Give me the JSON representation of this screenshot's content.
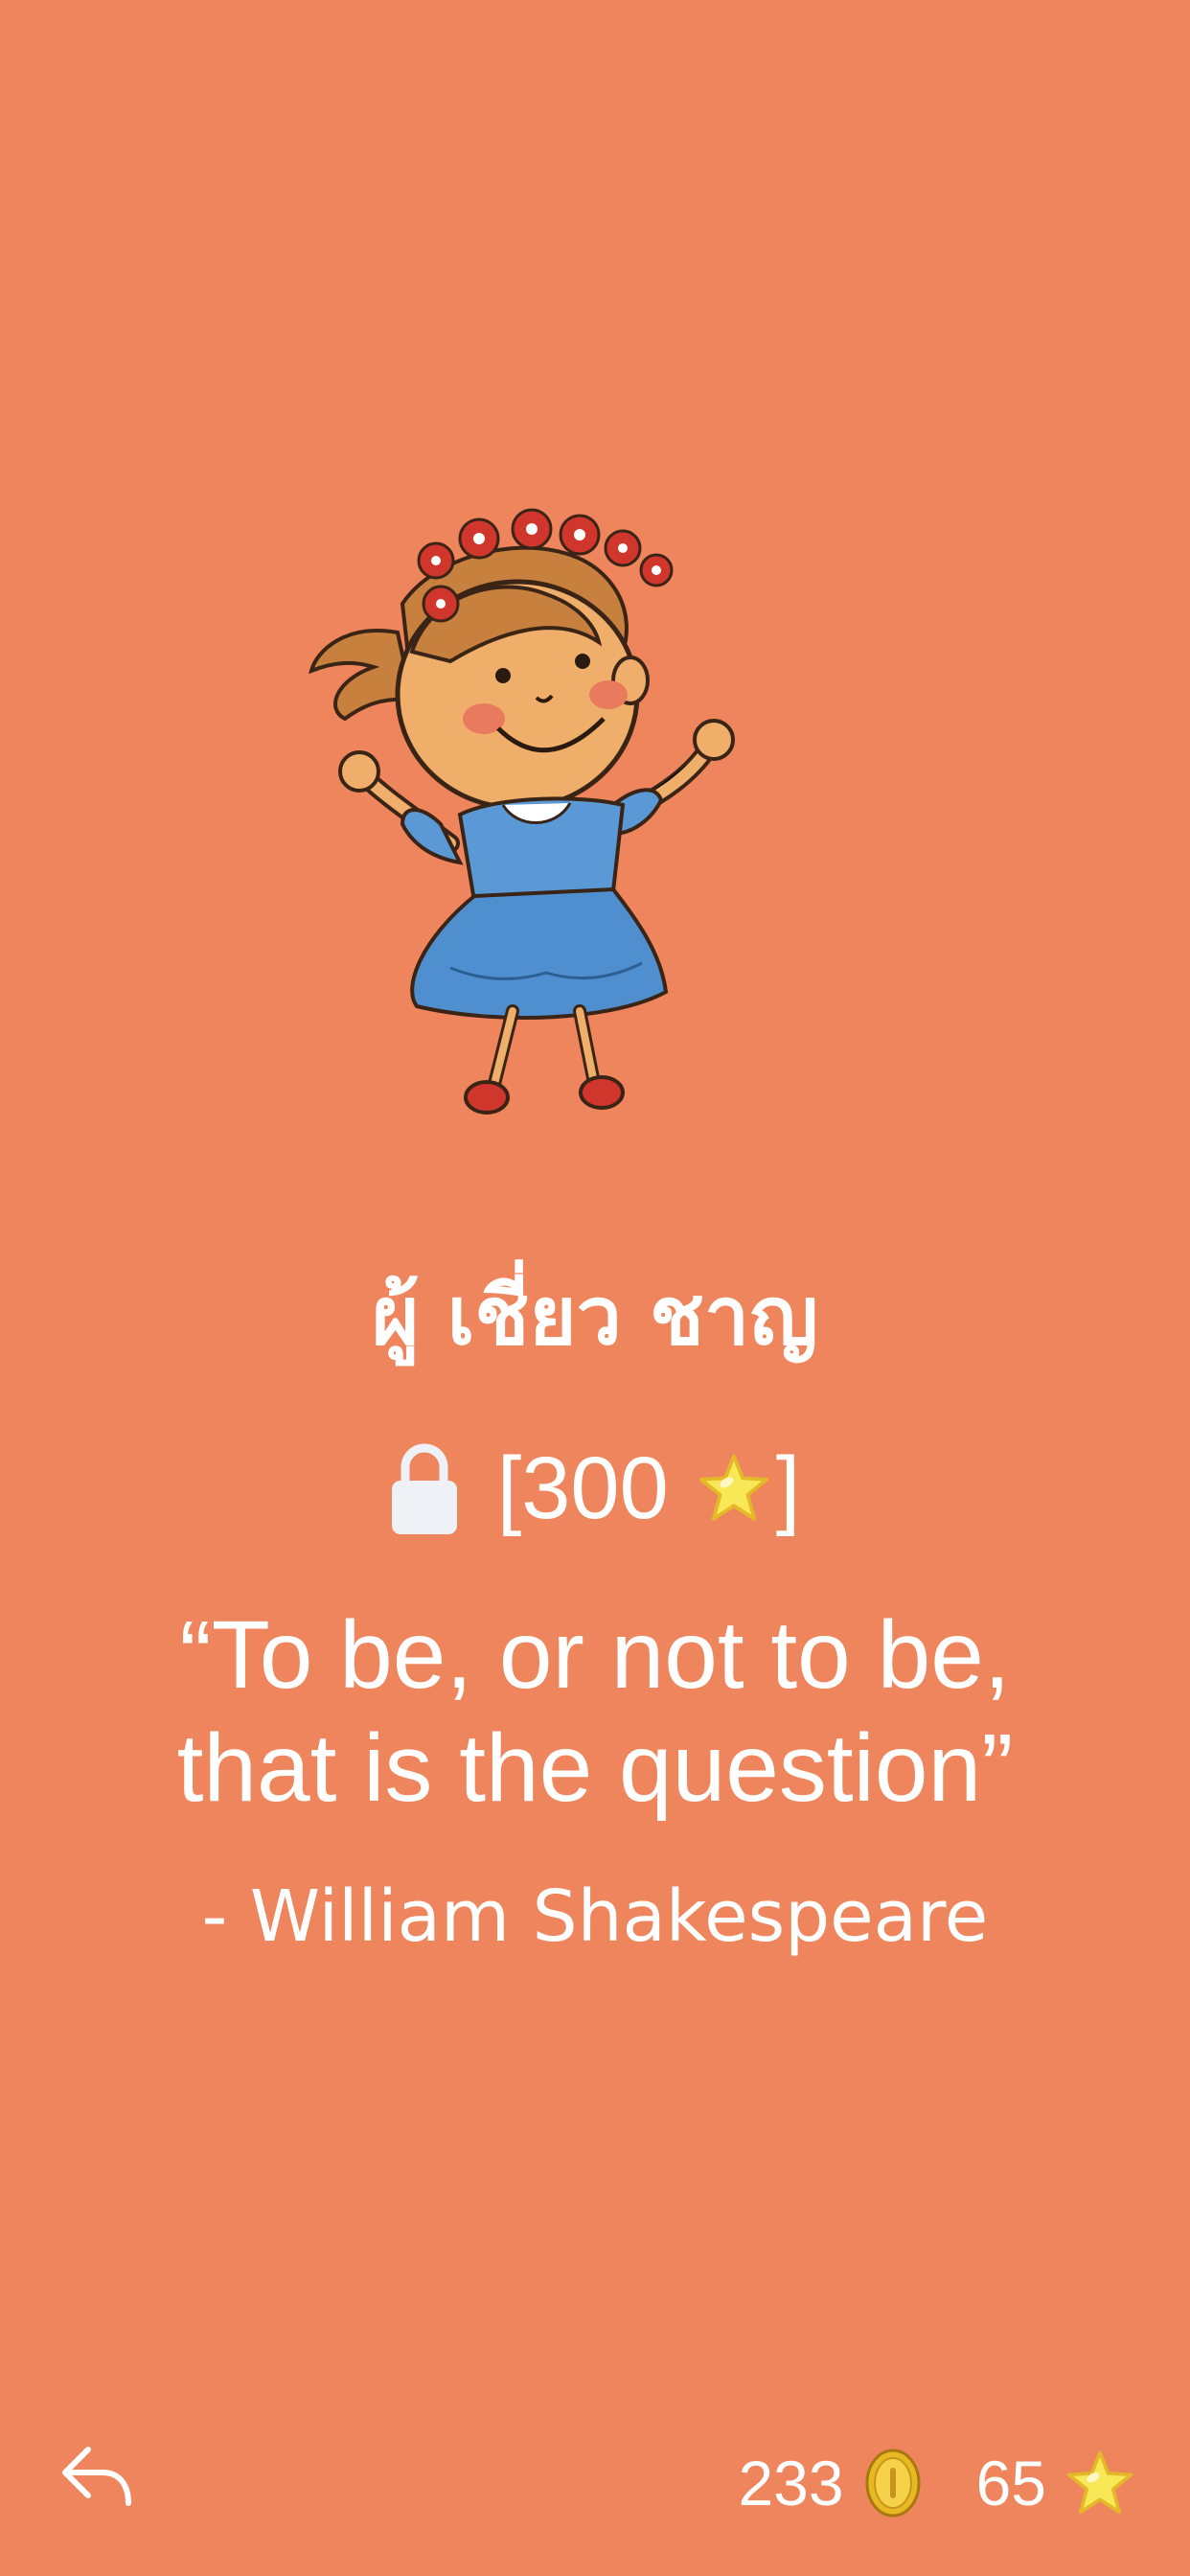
{
  "level": {
    "title": "ผู้ เชี่ยว ชาญ",
    "lock_open": "[",
    "lock_cost": "300",
    "lock_close": "]"
  },
  "quote": {
    "line1": "“To be, or not to be,",
    "line2": "that is the question”",
    "author": "- William Shakespeare"
  },
  "footer": {
    "coins": "233",
    "stars": "65"
  },
  "icons": {
    "back": "back-arrow-icon",
    "lock": "lock-icon",
    "coin": "coin-icon",
    "star": "star-icon"
  },
  "colors": {
    "background": "#ef855c",
    "text": "#ffffff",
    "star": "#f8e857",
    "coin": "#e8b923"
  }
}
